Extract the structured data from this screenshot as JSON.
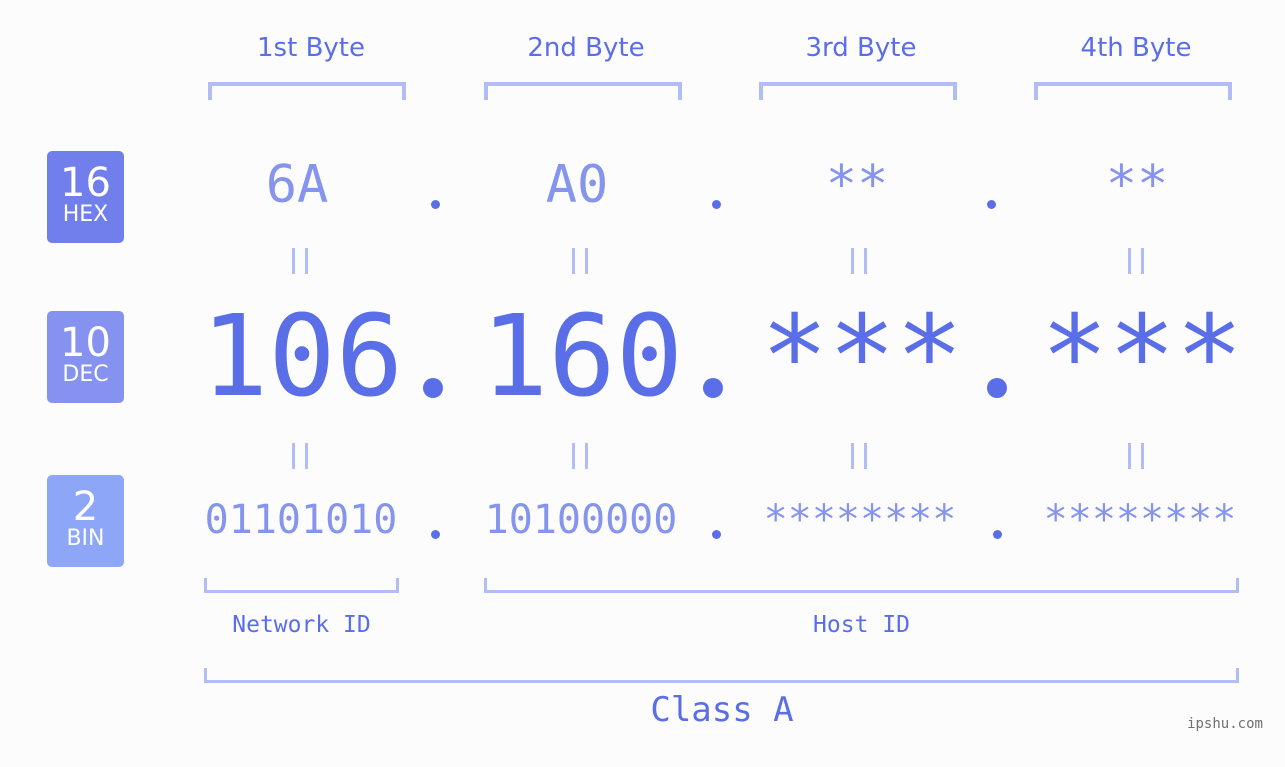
{
  "badges": [
    {
      "number": "16",
      "label": "HEX",
      "color": "#717fec"
    },
    {
      "number": "10",
      "label": "DEC",
      "color": "#8592f0"
    },
    {
      "number": "2",
      "label": "BIN",
      "color": "#8ea6f8"
    }
  ],
  "bytes": [
    {
      "header": "1st Byte",
      "hex": "6A",
      "dec": "106",
      "bin": "01101010"
    },
    {
      "header": "2nd Byte",
      "hex": "A0",
      "dec": "160",
      "bin": "10100000"
    },
    {
      "header": "3rd Byte",
      "hex": "**",
      "dec": "***",
      "bin": "********"
    },
    {
      "header": "4th Byte",
      "hex": "**",
      "dec": "***",
      "bin": "********"
    }
  ],
  "separator": ".",
  "segments": {
    "network": "Network ID",
    "host": "Host ID"
  },
  "ip_class": "Class A",
  "watermark": "ipshu.com",
  "colors": {
    "primary": "#5a6ee8",
    "secondary": "#8595ee",
    "bracket": "#b3bdf5",
    "background": "#fbfcfb"
  }
}
